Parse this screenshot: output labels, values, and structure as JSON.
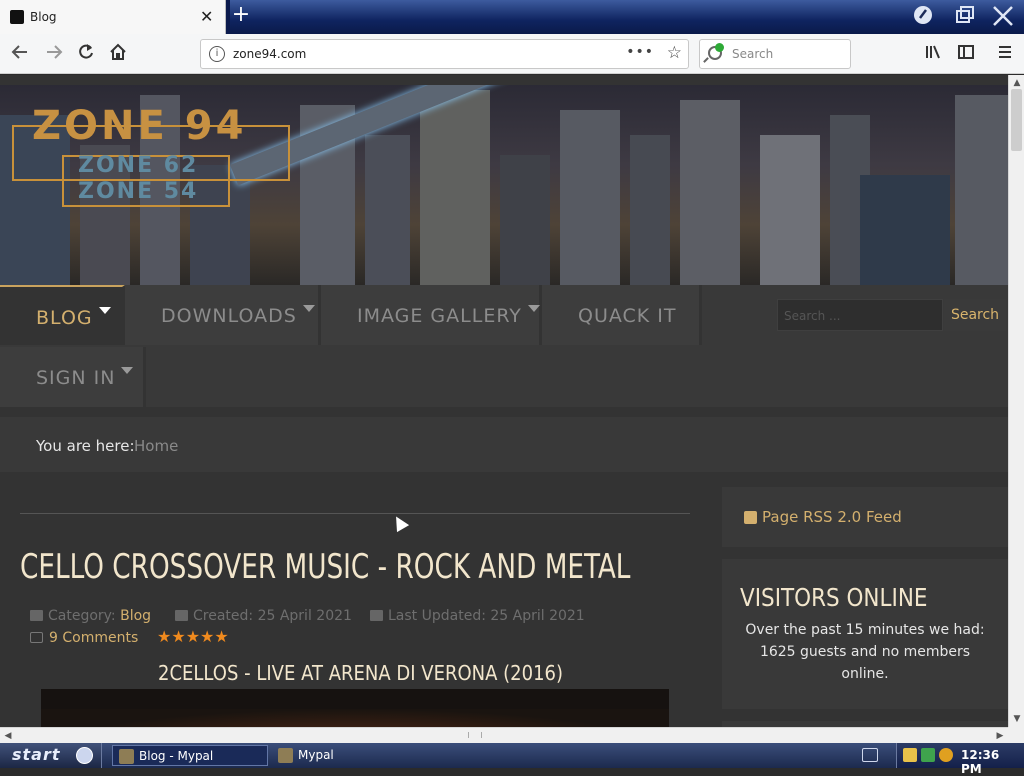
{
  "browser": {
    "tab_title": "Blog",
    "tab_close": "✕",
    "new_tab": "+",
    "url": "zone94.com",
    "url_actions": "•••",
    "search_placeholder": "Search",
    "icons": [
      "back-icon",
      "forward-icon",
      "reload-icon",
      "home-icon",
      "info-icon",
      "bookmark-star-icon",
      "library-icon",
      "sidebar-icon",
      "menu-icon",
      "minimize-icon",
      "restore-icon",
      "close-icon"
    ]
  },
  "site": {
    "logo": {
      "main": "ZONE 94",
      "sub1": "ZONE 62",
      "sub2": "ZONE 54"
    },
    "menu": [
      {
        "label": "BLOG",
        "caret": true,
        "active": true
      },
      {
        "label": "DOWNLOADS",
        "caret": true,
        "active": false
      },
      {
        "label": "IMAGE GALLERY",
        "caret": true,
        "active": false
      },
      {
        "label": "QUACK IT",
        "caret": false,
        "active": false
      },
      {
        "label": "SIGN IN",
        "caret": true,
        "active": false
      }
    ],
    "search": {
      "placeholder": "Search ...",
      "button": "Search"
    },
    "breadcrumb": {
      "lead": "You are here:",
      "home": "Home"
    },
    "article": {
      "title": "CELLO CROSSOVER MUSIC - ROCK AND METAL",
      "category_label": "Category:",
      "category": "Blog",
      "created": "Created: 25 April 2021",
      "updated": "Last Updated: 25 April 2021",
      "comments": "9 Comments",
      "rating": 5,
      "stars": "★★★★★",
      "subheading": "2CELLOS - LIVE AT ARENA DI VERONA (2016)"
    },
    "sidebar": {
      "rss": "Page RSS 2.0 Feed",
      "visitors_title": "VISITORS ONLINE",
      "visitors_text": "Over the past 15 minutes we had: 1625 guests and no members online."
    }
  },
  "taskbar": {
    "start": "start",
    "tasks": [
      {
        "label": "Blog - Mypal",
        "active": true
      },
      {
        "label": "Mypal",
        "active": false
      }
    ],
    "clock": "12:36 PM"
  },
  "colors": {
    "accent": "#d4b06e",
    "heading": "#f2e6cc",
    "page_bg": "#333333",
    "stars": "#f08a1e",
    "taskbar": "#1c2a4e"
  }
}
